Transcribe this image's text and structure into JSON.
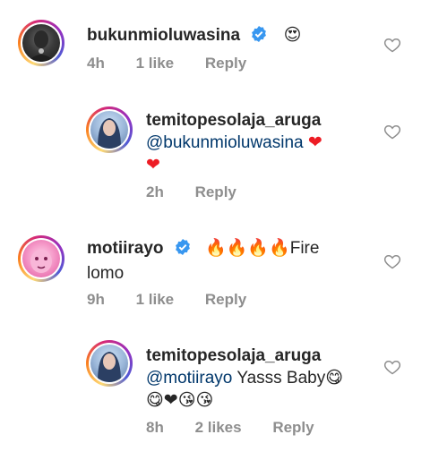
{
  "comments": [
    {
      "username": "bukunmioluwasina",
      "verified": true,
      "mention": "",
      "text": "",
      "emoji": "😍",
      "time": "4h",
      "likes": "1 like",
      "reply": "Reply"
    },
    {
      "username": "temitopesolaja_aruga",
      "verified": false,
      "mention": "@bukunmioluwasina",
      "text": "",
      "emoji_line1": "❤",
      "emoji_line2": "❤",
      "time": "2h",
      "likes": "",
      "reply": "Reply"
    },
    {
      "username": "motiirayo",
      "verified": true,
      "emoji": "🔥🔥🔥🔥",
      "text": "Fire",
      "text_line2": "lomo",
      "time": "9h",
      "likes": "1 like",
      "reply": "Reply"
    },
    {
      "username": "temitopesolaja_aruga",
      "verified": false,
      "mention": "@motiirayo",
      "text": "Yasss Baby",
      "emoji_line1": "😋",
      "emoji_line2": "😋❤😘😘",
      "time": "8h",
      "likes": "2 likes",
      "reply": "Reply"
    }
  ],
  "icons": {
    "verified": "verified-badge-icon",
    "like": "heart-outline-icon"
  },
  "colors": {
    "verified": "#3897f0",
    "heart": "#ed1c24",
    "mention": "#00376b",
    "meta": "#8e8e8e"
  }
}
